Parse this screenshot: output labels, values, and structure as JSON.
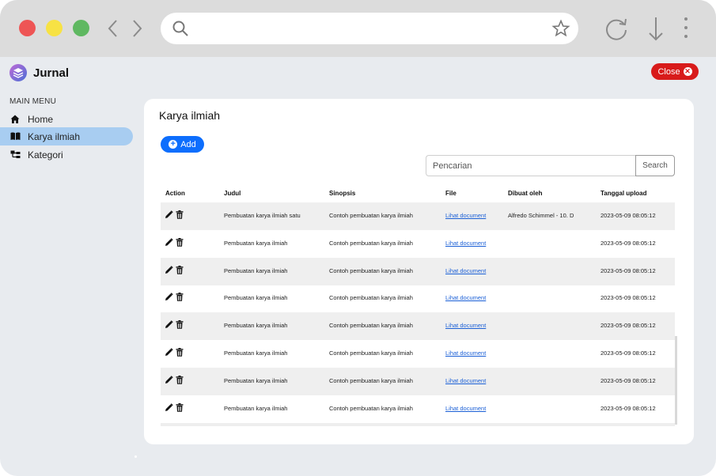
{
  "browser": {
    "url_value": "",
    "controls": [
      "back-icon",
      "forward-icon",
      "search-icon",
      "star-icon",
      "reload-icon",
      "download-icon",
      "more-icon"
    ]
  },
  "app": {
    "title": "Jurnal",
    "close_label": "Close"
  },
  "sidebar": {
    "menu_title": "MAIN MENU",
    "items": [
      {
        "label": "Home",
        "icon": "home-icon",
        "active": false
      },
      {
        "label": "Karya ilmiah",
        "icon": "book-icon",
        "active": true
      },
      {
        "label": "Kategori",
        "icon": "category-icon",
        "active": false
      }
    ]
  },
  "main": {
    "title": "Karya ilmiah",
    "add_label": "Add",
    "search_placeholder": "Pencarian",
    "search_button": "Search",
    "columns": [
      "Action",
      "Judul",
      "Sinopsis",
      "File",
      "Dibuat oleh",
      "Tanggal upload"
    ],
    "rows": [
      {
        "judul": "Pembuatan karya ilmiah satu",
        "sinopsis": "Contoh pembuatan karya ilmiah",
        "file": "Lihat document",
        "dibuat_oleh": "Alfredo Schimmel - 10. D",
        "tanggal": "2023-05-09 08:05:12"
      },
      {
        "judul": "Pembuatan karya ilmiah",
        "sinopsis": "Contoh pembuatan karya ilmiah",
        "file": "Lihat document",
        "dibuat_oleh": "",
        "tanggal": "2023-05-09 08:05:12"
      },
      {
        "judul": "Pembuatan karya ilmiah",
        "sinopsis": "Contoh pembuatan karya ilmiah",
        "file": "Lihat document",
        "dibuat_oleh": "",
        "tanggal": "2023-05-09 08:05:12"
      },
      {
        "judul": "Pembuatan karya ilmiah",
        "sinopsis": "Contoh pembuatan karya ilmiah",
        "file": "Lihat document",
        "dibuat_oleh": "",
        "tanggal": "2023-05-09 08:05:12"
      },
      {
        "judul": "Pembuatan karya ilmiah",
        "sinopsis": "Contoh pembuatan karya ilmiah",
        "file": "Lihat document",
        "dibuat_oleh": "",
        "tanggal": "2023-05-09 08:05:12"
      },
      {
        "judul": "Pembuatan karya ilmiah",
        "sinopsis": "Contoh pembuatan karya ilmiah",
        "file": "Lihat document",
        "dibuat_oleh": "",
        "tanggal": "2023-05-09 08:05:12"
      },
      {
        "judul": "Pembuatan karya ilmiah",
        "sinopsis": "Contoh pembuatan karya ilmiah",
        "file": "Lihat document",
        "dibuat_oleh": "",
        "tanggal": "2023-05-09 08:05:12"
      },
      {
        "judul": "Pembuatan karya ilmiah",
        "sinopsis": "Contoh pembuatan karya ilmiah",
        "file": "Lihat document",
        "dibuat_oleh": "",
        "tanggal": "2023-05-09 08:05:12"
      }
    ]
  },
  "colors": {
    "close": "#d81b1b",
    "primary": "#0d6efd",
    "active_menu": "#a8cdf1",
    "link": "#1a5fd6",
    "background": "#e8ebef"
  }
}
